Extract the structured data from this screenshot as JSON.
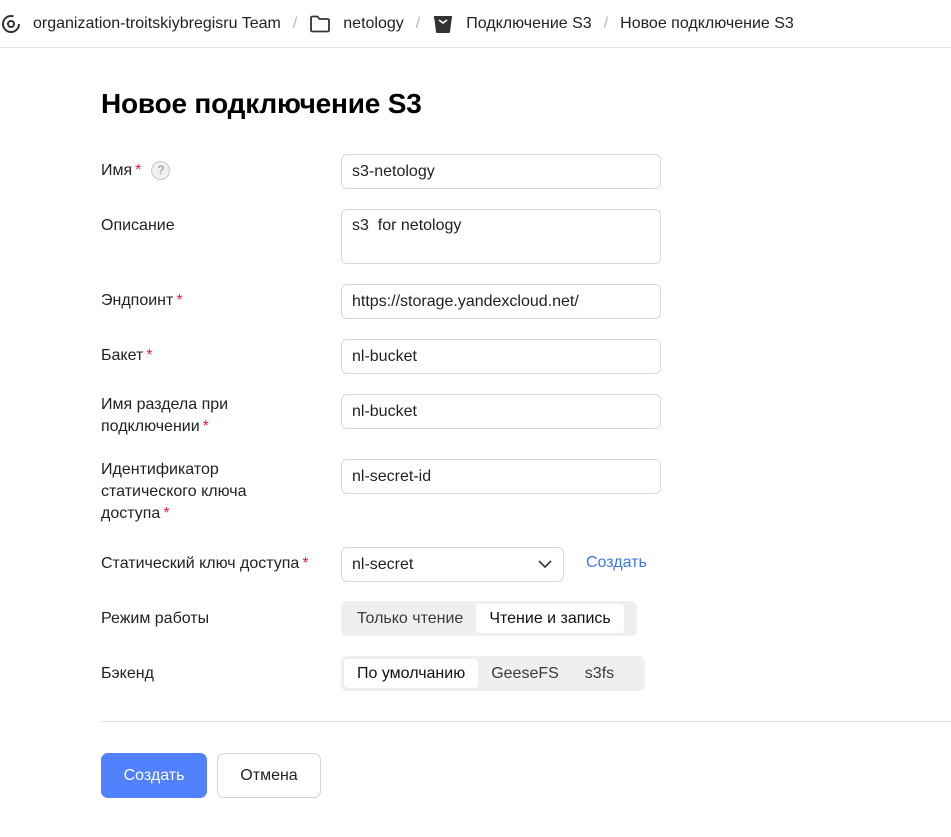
{
  "breadcrumbs": {
    "organization": "organization-troitskiybregisru Team",
    "folder": "netology",
    "connection_type": "Подключение S3",
    "current": "Новое подключение S3",
    "separator": "/"
  },
  "page": {
    "title": "Новое подключение S3"
  },
  "form": {
    "name": {
      "label": "Имя",
      "required_mark": "*",
      "help": "?",
      "value": "s3-netology"
    },
    "description": {
      "label": "Описание",
      "value": "s3  for netology"
    },
    "endpoint": {
      "label": "Эндпоинт",
      "required_mark": "*",
      "value": "https://storage.yandexcloud.net/"
    },
    "bucket": {
      "label": "Бакет",
      "required_mark": "*",
      "value": "nl-bucket"
    },
    "mount_name": {
      "label_line1": "Имя раздела при",
      "label_line2": "подключении",
      "required_mark": "*",
      "value": "nl-bucket"
    },
    "static_key_id": {
      "label_line1": "Идентификатор",
      "label_line2": "статического ключа",
      "label_line3": "доступа",
      "required_mark": "*",
      "value": "nl-secret-id"
    },
    "static_key": {
      "label": "Статический ключ доступа",
      "required_mark": "*",
      "value": "nl-secret",
      "create_link": "Создать"
    },
    "mode": {
      "label": "Режим работы",
      "options": [
        "Только чтение",
        "Чтение и запись"
      ],
      "selected": "Чтение и запись"
    },
    "backend": {
      "label": "Бэкенд",
      "options": [
        "По умолчанию",
        "GeeseFS",
        "s3fs"
      ],
      "selected": "По умолчанию"
    }
  },
  "actions": {
    "create": "Создать",
    "cancel": "Отмена"
  },
  "colors": {
    "primary": "#5281ff",
    "link": "#3c74eb",
    "required": "#e0263b"
  },
  "icons": {
    "organization": "organization-icon",
    "folder": "folder-icon",
    "s3_connection": "bucket-icon",
    "select_arrow": "chevron-down-icon",
    "help": "question-icon"
  }
}
